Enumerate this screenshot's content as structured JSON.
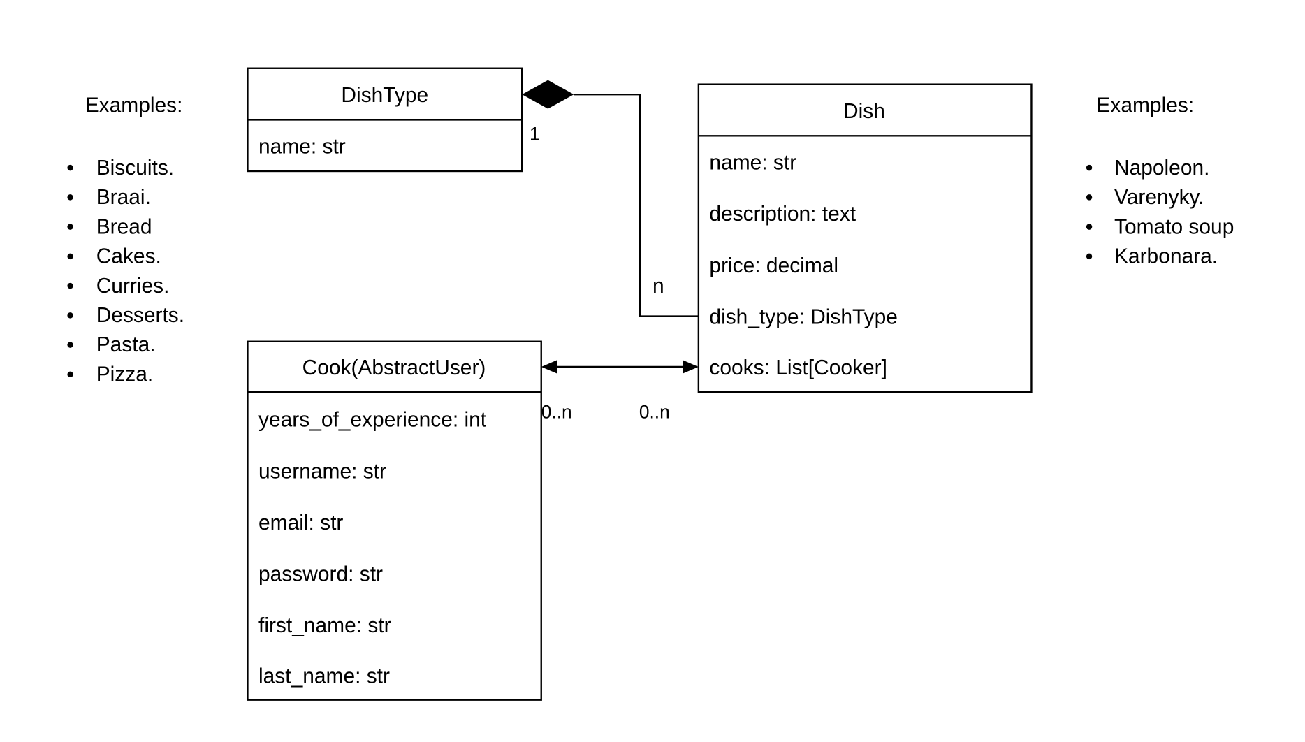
{
  "left_examples": {
    "title": "Examples:",
    "items": [
      "Biscuits.",
      "Braai.",
      "Bread",
      "Cakes.",
      "Curries.",
      "Desserts.",
      "Pasta.",
      "Pizza."
    ]
  },
  "right_examples": {
    "title": "Examples:",
    "items": [
      "Napoleon.",
      "Varenyky.",
      "Tomato soup",
      "Karbonara."
    ]
  },
  "classes": {
    "dishtype": {
      "name": "DishType",
      "fields": [
        "name: str"
      ]
    },
    "dish": {
      "name": "Dish",
      "fields": [
        "name: str",
        "description: text",
        "price: decimal",
        "dish_type: DishType",
        "cooks: List[Cooker]"
      ]
    },
    "cook": {
      "name": "Cook(AbstractUser)",
      "fields": [
        "years_of_experience: int",
        "username: str",
        "email: str",
        "password: str",
        "first_name: str",
        "last_name: str"
      ]
    }
  },
  "relations": {
    "dishtype_dish": {
      "type": "composition",
      "source_multiplicity": "1",
      "target_multiplicity": "n"
    },
    "cook_dish": {
      "type": "bidirectional-association",
      "cook_multiplicity": "0..n",
      "dish_multiplicity": "0..n"
    }
  }
}
